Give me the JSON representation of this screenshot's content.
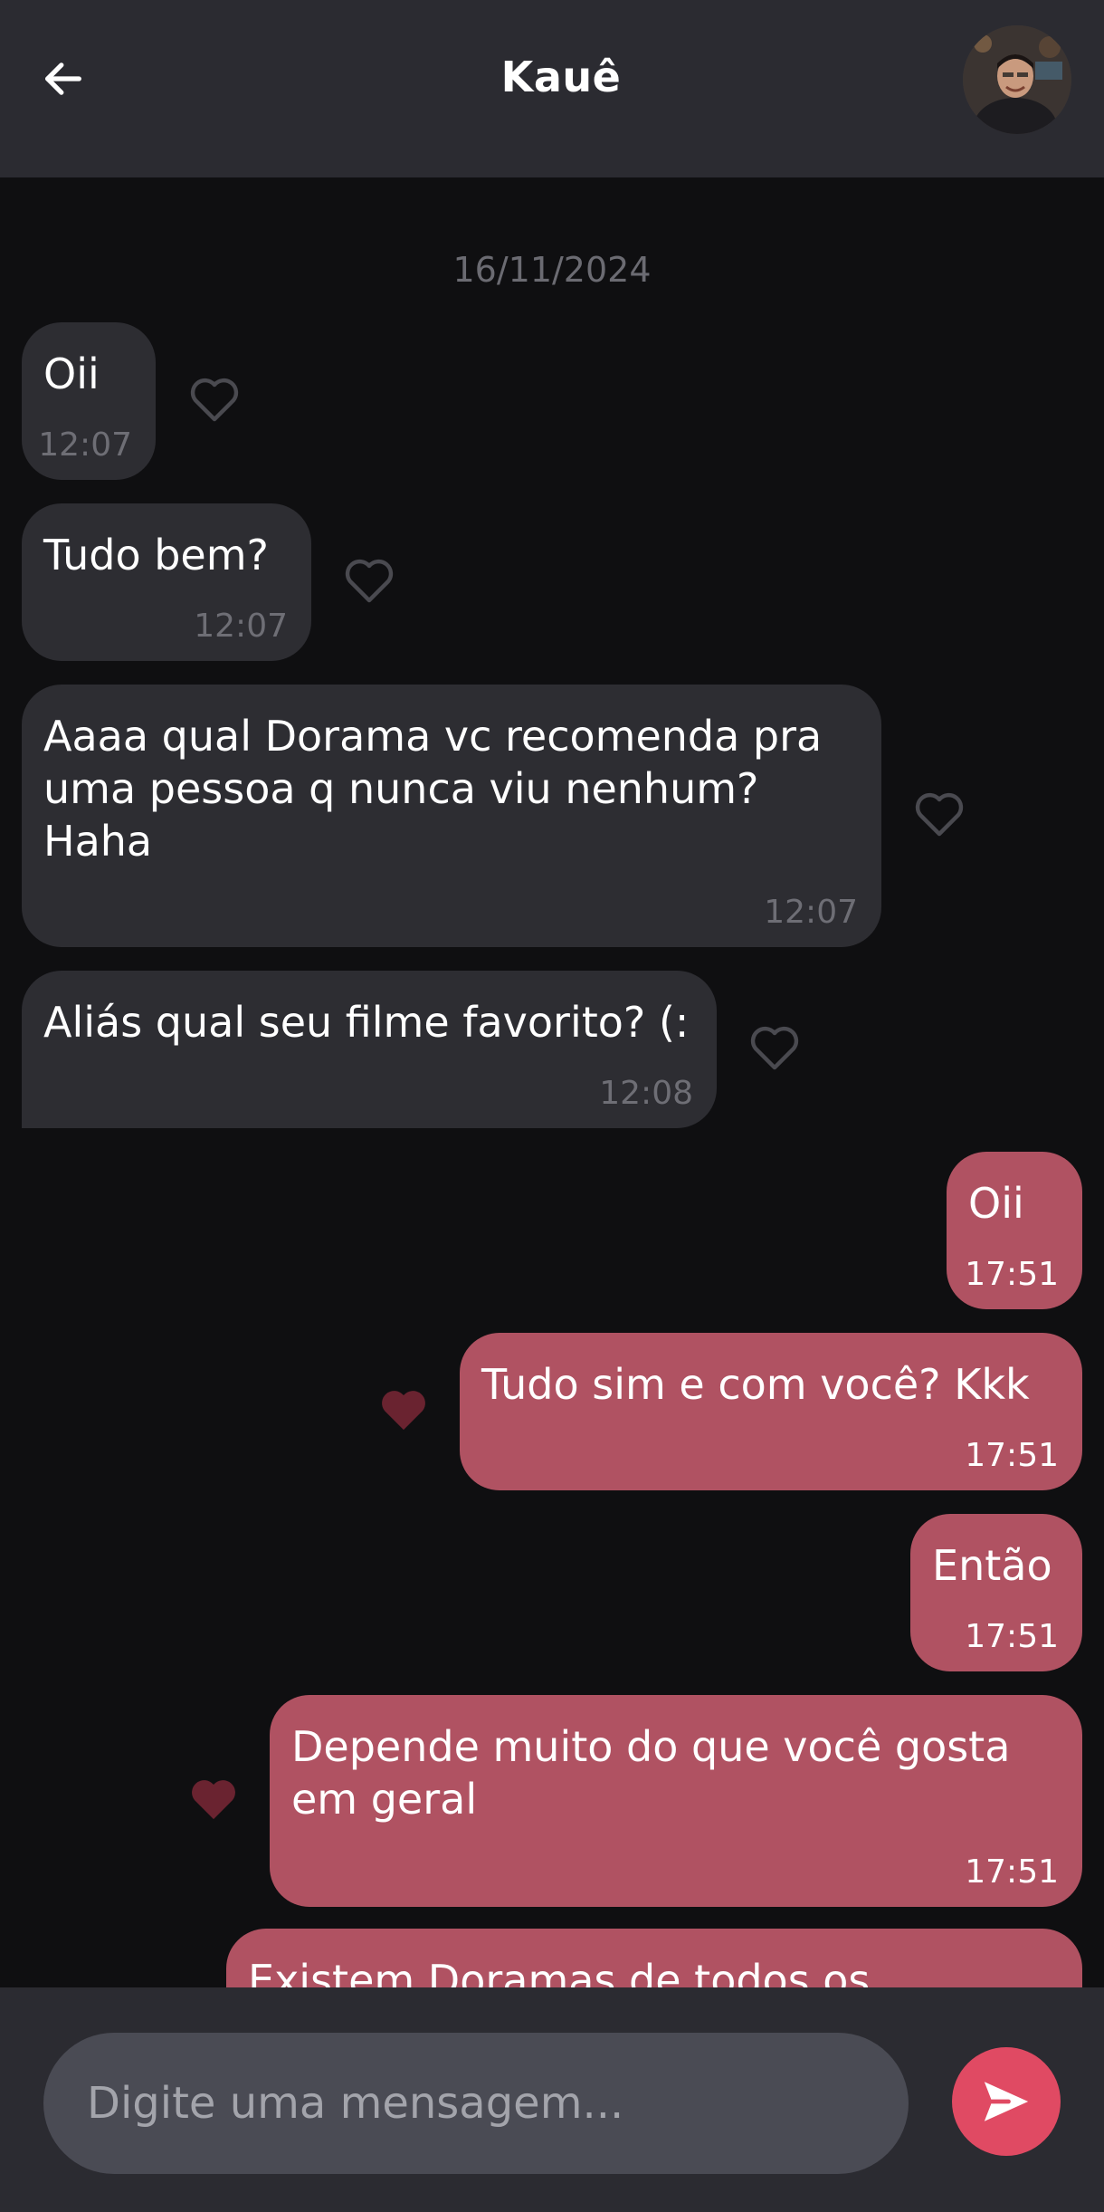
{
  "header": {
    "title": "Kauê"
  },
  "messages": {
    "date": "16/11/2024",
    "items": [
      {
        "text": "Oii",
        "time": "12:07",
        "liked": false
      },
      {
        "text": "Tudo bem?",
        "time": "12:07",
        "liked": false
      },
      {
        "text": "Aaaa qual Dorama vc recomenda pra\numa pessoa q nunca viu nenhum?\nHaha",
        "time": "12:07",
        "liked": false
      },
      {
        "text": "Aliás qual seu filme favorito? (:",
        "time": "12:08",
        "liked": false
      },
      {
        "text": "Oii",
        "time": "17:51",
        "liked": false
      },
      {
        "text": "Tudo sim e com você? Kkk",
        "time": "17:51",
        "liked": true
      },
      {
        "text": "Então",
        "time": "17:51",
        "liked": false
      },
      {
        "text": "Depende muito do que você gosta\nem geral",
        "time": "17:51",
        "liked": true
      },
      {
        "text": "Existem Doramas de todos os",
        "time": "",
        "liked": false
      }
    ]
  },
  "composer": {
    "placeholder": "Digite uma mensagem..."
  },
  "colors": {
    "background": "#0f0f11",
    "header": "#2b2b31",
    "incoming_bubble": "#2d2d32",
    "outgoing_bubble": "#b05262",
    "send_button": "#e04a63",
    "liked_heart": "#6a2330",
    "unliked_heart": "#4a4a50"
  },
  "icons": {
    "back": "arrow-left-icon",
    "heart": "heart-icon",
    "send": "paper-plane-icon"
  }
}
